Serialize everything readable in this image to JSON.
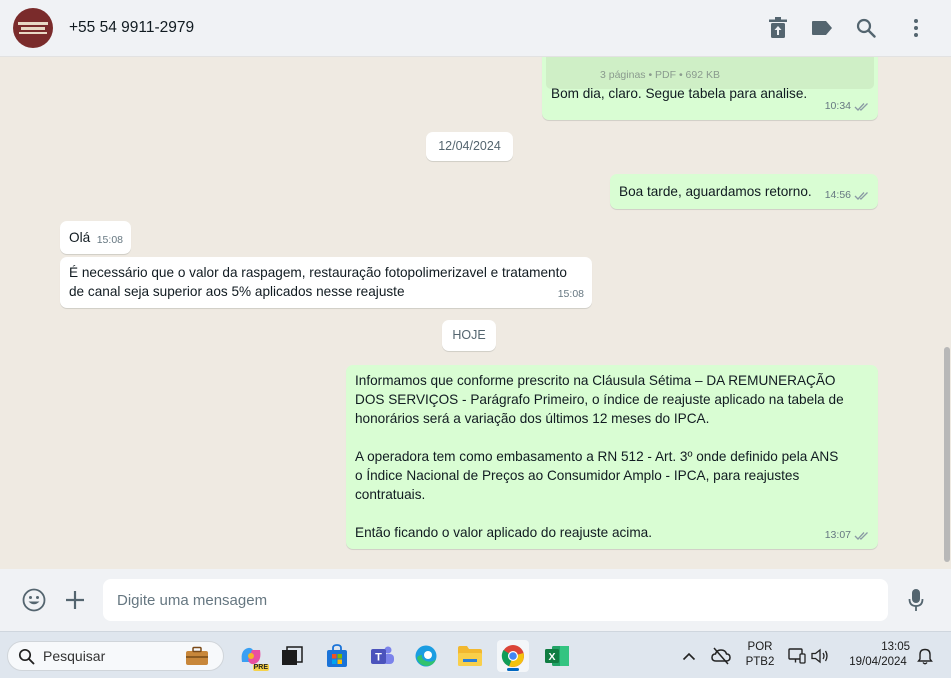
{
  "header": {
    "contact": "+55 54 9911-2979"
  },
  "messages": {
    "doc_meta": "3 páginas • PDF • 692 KB",
    "m1": {
      "text": "Bom dia, claro. Segue tabela para analise.",
      "time": "10:34"
    },
    "date1": "12/04/2024",
    "m2": {
      "text": "Boa tarde, aguardamos retorno.",
      "time": "14:56"
    },
    "m3": {
      "text": "Olá",
      "time": "15:08"
    },
    "m4": {
      "line1": "É necessário que o valor da raspagem, restauração fotopolimerizavel e tratamento",
      "line2": "de canal seja superior aos 5% aplicados nesse reajuste",
      "time": "15:08"
    },
    "date2": "HOJE",
    "m5": {
      "p1l1": "Informamos que conforme prescrito na Cláusula Sétima – DA REMUNERAÇÃO",
      "p1l2": "DOS SERVIÇOS - Parágrafo Primeiro, o índice de reajuste aplicado na tabela de",
      "p1l3": "honorários será a variação dos últimos 12 meses do IPCA.",
      "p2l1": "A operadora tem como embasamento a RN 512 - Art. 3º onde definido pela ANS",
      "p2l2": "o Índice Nacional de Preços ao Consumidor Amplo - IPCA, para reajustes",
      "p2l3": "contratuais.",
      "p3l1": "Então ficando o valor aplicado do reajuste acima.",
      "time": "13:07"
    }
  },
  "composer": {
    "placeholder": "Digite uma mensagem"
  },
  "taskbar": {
    "search_label": "Pesquisar",
    "lang_line1": "POR",
    "lang_line2": "PTB2",
    "clock_time": "13:05",
    "clock_date": "19/04/2024",
    "copilot_badge": "PRE"
  },
  "colors": {
    "outgoing": "#d9fdd3",
    "incoming": "#ffffff",
    "tick": "#53bdeb",
    "wallpaper": "#efeae2"
  }
}
